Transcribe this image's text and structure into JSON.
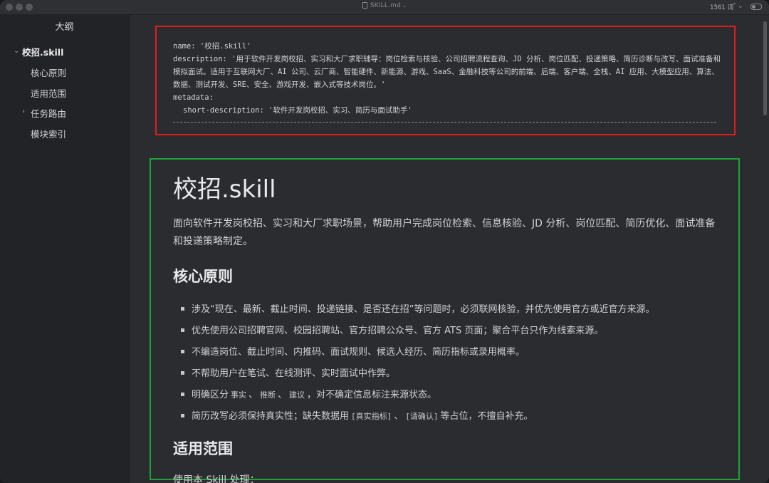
{
  "titlebar": {
    "file_name": "SKILL.md",
    "caret": "⌄",
    "word_count": "1561 词",
    "stepper_icon": "⌃⌄"
  },
  "sidebar": {
    "title": "大纲",
    "items": [
      {
        "label": "校招.skill",
        "expanded": true
      },
      {
        "label": "核心原则"
      },
      {
        "label": "适用范围"
      },
      {
        "label": "任务路由",
        "collapsed": true
      },
      {
        "label": "模块索引"
      }
    ]
  },
  "frontmatter": {
    "name_line": "name: '校招.skill'",
    "description_line": "description: '用于软件开发岗校招、实习和大厂求职辅导：岗位检索与核验、公司招聘流程查询、JD 分析、岗位匹配、投递策略、简历诊断与改写、面试准备和模拟面试。适用于互联网大厂、AI 公司、云厂商、智能硬件、新能源、游戏、SaaS、金融科技等公司的前端、后端、客户端、全栈、AI 应用、大模型应用、算法、数据、测试开发、SRE、安全、游戏开发、嵌入式等技术岗位。'",
    "metadata_line": "metadata:",
    "short_desc_line": "short-description: '软件开发岗校招、实习、简历与面试助手'"
  },
  "document": {
    "h1": "校招.skill",
    "intro": "面向软件开发岗校招、实习和大厂求职场景，帮助用户完成岗位检索、信息核验、JD 分析、岗位匹配、简历优化、面试准备和投递策略制定。",
    "h2_principles": "核心原则",
    "principles": {
      "p1": "涉及“现在、最新、截止时间、投递链接、是否还在招”等问题时，必须联网核验，并优先使用官方或近官方来源。",
      "p2": "优先使用公司招聘官网、校园招聘站、官方招聘公众号、官方 ATS 页面；聚合平台只作为线索来源。",
      "p3": "不编造岗位、截止时间、内推码、面试规则、候选人经历、简历指标或录用概率。",
      "p4": "不帮助用户在笔试、在线测评、实时面试中作弊。",
      "p5_pre": "明确区分",
      "p5_k1": "事实",
      "p5_sep1": "、",
      "p5_k2": "推断",
      "p5_sep2": "、",
      "p5_k3": "建议",
      "p5_post": "，对不确定信息标注来源状态。",
      "p6_pre": "简历改写必须保持真实性；缺失数据用",
      "p6_k1": "[真实指标]",
      "p6_sep": "、",
      "p6_k2": "[请确认]",
      "p6_post": "等占位，不擅自补充。"
    },
    "h2_scope": "适用范围",
    "scope_intro": "使用本 Skill 处理："
  }
}
